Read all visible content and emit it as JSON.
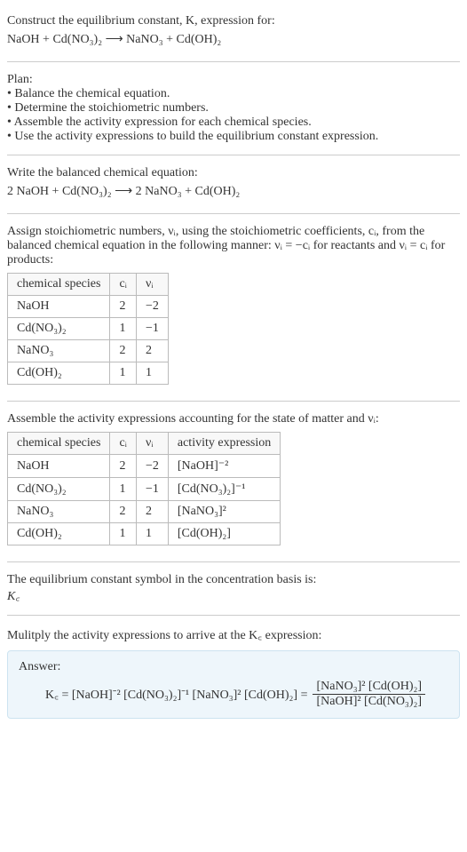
{
  "prompt": {
    "line1": "Construct the equilibrium constant, K, expression for:",
    "equation": "NaOH + Cd(NO₃)₂ ⟶ NaNO₃ + Cd(OH)₂"
  },
  "plan": {
    "title": "Plan:",
    "items": [
      "• Balance the chemical equation.",
      "• Determine the stoichiometric numbers.",
      "• Assemble the activity expression for each chemical species.",
      "• Use the activity expressions to build the equilibrium constant expression."
    ]
  },
  "balanced": {
    "title": "Write the balanced chemical equation:",
    "equation": "2 NaOH + Cd(NO₃)₂ ⟶ 2 NaNO₃ + Cd(OH)₂"
  },
  "stoich": {
    "desc": "Assign stoichiometric numbers, νᵢ, using the stoichiometric coefficients, cᵢ, from the balanced chemical equation in the following manner: νᵢ = −cᵢ for reactants and νᵢ = cᵢ for products:",
    "headers": {
      "species": "chemical species",
      "ci": "cᵢ",
      "vi": "νᵢ"
    },
    "rows": [
      {
        "species": "NaOH",
        "ci": "2",
        "vi": "−2"
      },
      {
        "species": "Cd(NO₃)₂",
        "ci": "1",
        "vi": "−1"
      },
      {
        "species": "NaNO₃",
        "ci": "2",
        "vi": "2"
      },
      {
        "species": "Cd(OH)₂",
        "ci": "1",
        "vi": "1"
      }
    ]
  },
  "activity": {
    "desc": "Assemble the activity expressions accounting for the state of matter and νᵢ:",
    "headers": {
      "species": "chemical species",
      "ci": "cᵢ",
      "vi": "νᵢ",
      "expr": "activity expression"
    },
    "rows": [
      {
        "species": "NaOH",
        "ci": "2",
        "vi": "−2",
        "expr": "[NaOH]⁻²"
      },
      {
        "species": "Cd(NO₃)₂",
        "ci": "1",
        "vi": "−1",
        "expr": "[Cd(NO₃)₂]⁻¹"
      },
      {
        "species": "NaNO₃",
        "ci": "2",
        "vi": "2",
        "expr": "[NaNO₃]²"
      },
      {
        "species": "Cd(OH)₂",
        "ci": "1",
        "vi": "1",
        "expr": "[Cd(OH)₂]"
      }
    ]
  },
  "symbol": {
    "line1": "The equilibrium constant symbol in the concentration basis is:",
    "line2": "K꜀"
  },
  "multiply": "Mulitply the activity expressions to arrive at the K꜀ expression:",
  "answer": {
    "label": "Answer:",
    "lhs": "K꜀ = [NaOH]⁻² [Cd(NO₃)₂]⁻¹ [NaNO₃]² [Cd(OH)₂] =",
    "frac_num": "[NaNO₃]² [Cd(OH)₂]",
    "frac_den": "[NaOH]² [Cd(NO₃)₂]"
  }
}
